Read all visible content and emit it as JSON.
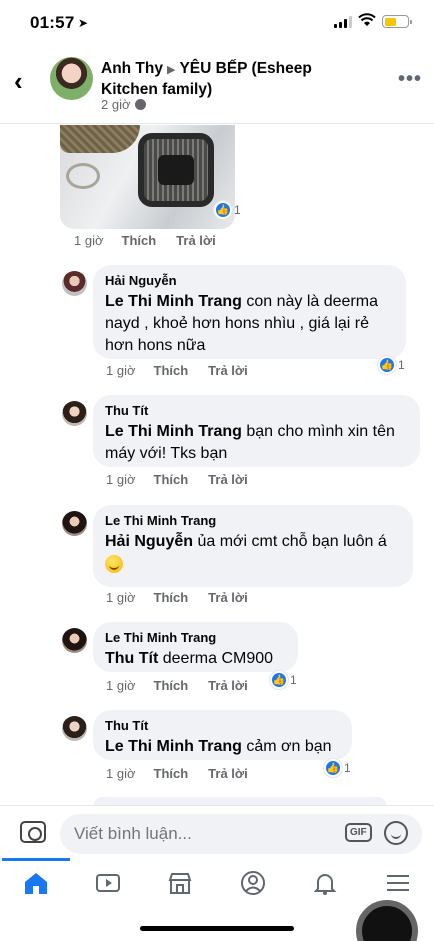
{
  "status": {
    "time": "01:57"
  },
  "header": {
    "author": "Anh Thy",
    "group": "YÊU BẾP (Esheep Kitchen family)",
    "time": "2 giờ"
  },
  "top_comment": {
    "reactions": "1",
    "time": "1 giờ",
    "like": "Thích",
    "reply": "Trả lời"
  },
  "comments": [
    {
      "name": "Hải Nguyễn",
      "mention": "Le Thi Minh Trang",
      "text": " con này là deerma nayd , khoẻ hơn hons nhìu , giá lại rẻ hơn hons nữa",
      "time": "1 giờ",
      "like": "Thích",
      "reply": "Trả lời",
      "reactions": "1"
    },
    {
      "name": "Thu Tít",
      "mention": "Le Thi Minh Trang",
      "text": " bạn cho mình xin tên máy với! Tks bạn",
      "time": "1 giờ",
      "like": "Thích",
      "reply": "Trả lời"
    },
    {
      "name": "Le Thi Minh Trang",
      "mention": "Hải Nguyễn",
      "text": " ủa mới cmt chỗ bạn luôn á",
      "time": "1 giờ",
      "like": "Thích",
      "reply": "Trả lời"
    },
    {
      "name": "Le Thi Minh Trang",
      "mention": "Thu Tít",
      "text": " deerma CM900",
      "time": "1 giờ",
      "like": "Thích",
      "reply": "Trả lời",
      "reactions": "1"
    },
    {
      "name": "Thu Tít",
      "mention": "Le Thi Minh Trang",
      "text": " cảm ơn bạn",
      "time": "1 giờ",
      "like": "Thích",
      "reply": "Trả lời",
      "reactions": "1"
    }
  ],
  "composer": {
    "placeholder": "Viết bình luận...",
    "gif": "GIF"
  },
  "colors": {
    "accent": "#1877f2",
    "bubble": "#f0f2f5",
    "meta": "#65676b"
  }
}
